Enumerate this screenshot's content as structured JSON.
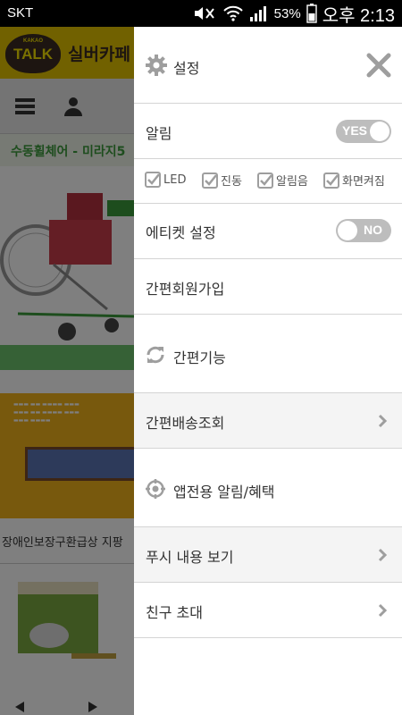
{
  "status_bar": {
    "carrier": "SKT",
    "battery": "53%",
    "time": "오후 2:13"
  },
  "background_app": {
    "logo_small": "KAKAO",
    "logo": "TALK",
    "title": "실버카페",
    "product_title": "수동휠체어 - 미라지5",
    "ticker": "장애인보장구환급상  지팡"
  },
  "drawer": {
    "title": "설정",
    "notification": {
      "label": "알림",
      "toggle": "YES"
    },
    "options": [
      {
        "label": "LED",
        "checked": true
      },
      {
        "label": "진동",
        "checked": true
      },
      {
        "label": "알림음",
        "checked": true
      },
      {
        "label": "화면켜짐",
        "checked": true
      }
    ],
    "etiquette": {
      "label": "에티켓 설정",
      "toggle": "NO"
    },
    "simple_signup": "간편회원가입",
    "simple_features": "간편기능",
    "delivery_lookup": "간편배송조회",
    "app_notices": "앱전용 알림/혜택",
    "push_view": "푸시 내용 보기",
    "invite": "친구 초대"
  },
  "colors": {
    "toggle_bg": "#bdbdbd",
    "icon_gray": "#9e9e9e",
    "kakao_yellow": "#e3c200"
  }
}
